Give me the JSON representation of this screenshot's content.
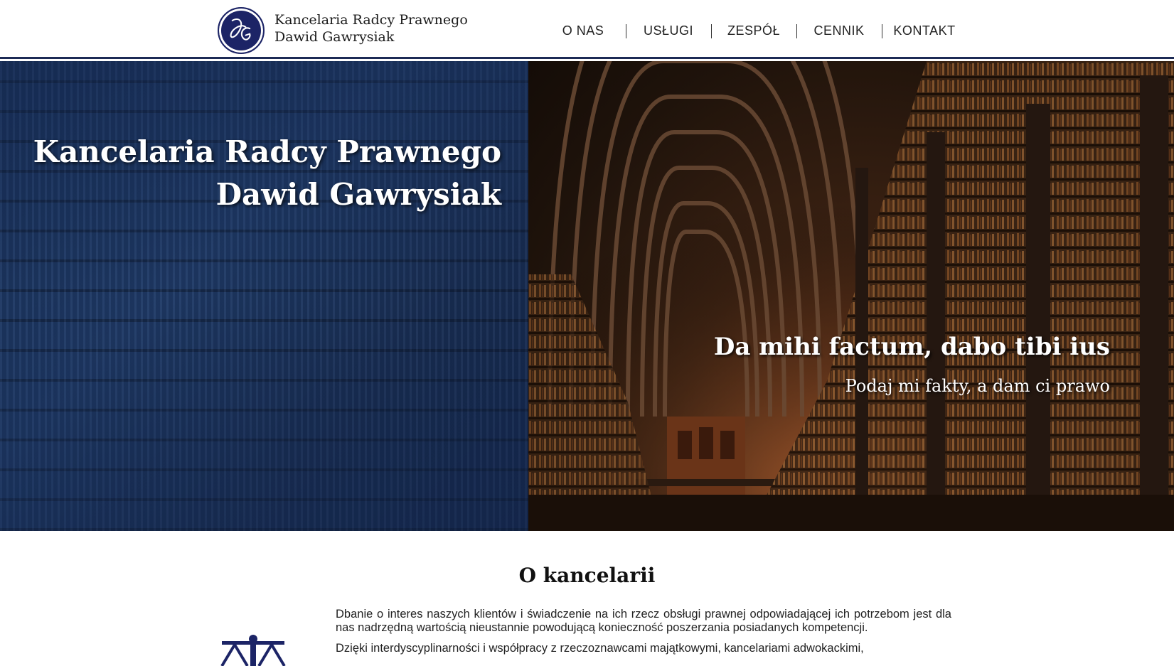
{
  "header": {
    "logo_icon": "dg-monogram-logo",
    "brand_line1": "Kancelaria Radcy Prawnego",
    "brand_line2": "Dawid Gawrysiak",
    "nav": [
      {
        "label": "O NAS"
      },
      {
        "label": "USŁUGI"
      },
      {
        "label": "ZESPÓŁ"
      },
      {
        "label": "CENNIK"
      },
      {
        "label": "KONTAKT"
      }
    ]
  },
  "hero": {
    "title_line1": "Kancelaria Radcy Prawnego",
    "title_line2": "Dawid Gawrysiak",
    "quote": "Da mihi factum, dabo tibi ius",
    "quote_translation": "Podaj mi fakty, a dam ci prawo"
  },
  "about": {
    "heading": "O kancelarii",
    "icon": "scales-of-justice-icon",
    "paragraph1": "Dbanie o interes naszych klientów i świadczenie na ich rzecz obsługi prawnej odpowiadającej ich potrzebom jest dla nas nadrzędną wartością nieustannie powodującą konieczność poszerzania posiadanych kompetencji.",
    "paragraph2": "Dzięki interdyscyplinarności i współpracy z rzeczoznawcami majątkowymi, kancelariami adwokackimi,"
  },
  "colors": {
    "navy": "#1c2466",
    "header_border": "#1c2a55",
    "hero_left_overlay": "#1b3560"
  }
}
